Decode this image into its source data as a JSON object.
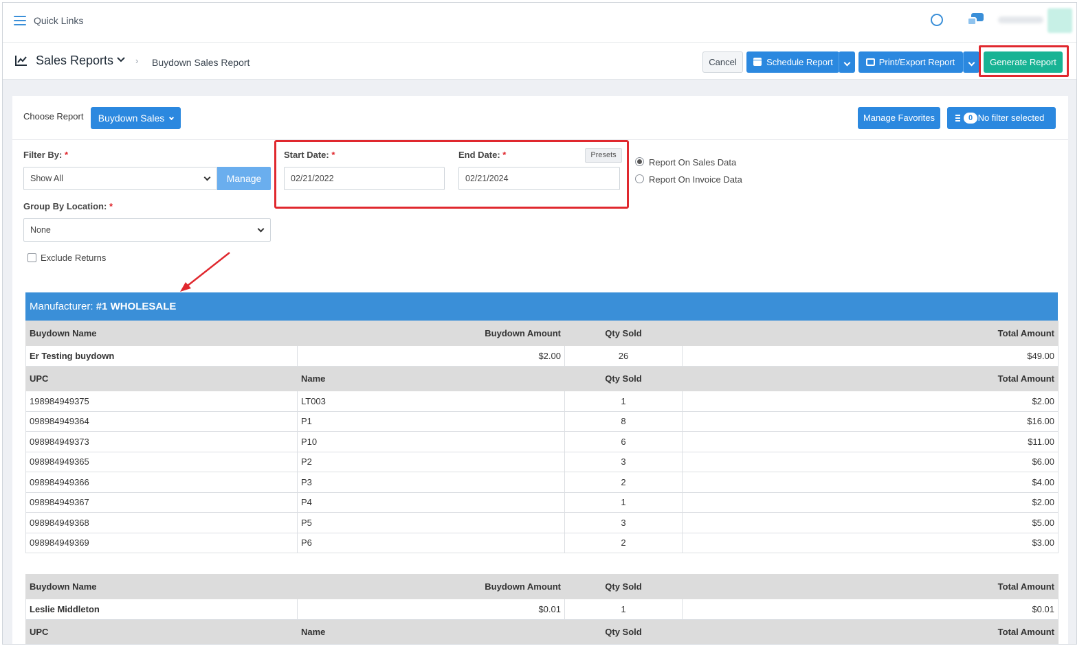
{
  "topbar": {
    "quick_links": "Quick Links"
  },
  "header": {
    "title": "Sales Reports",
    "breadcrumb_current": "Buydown Sales Report",
    "cancel": "Cancel",
    "schedule": "Schedule Report",
    "print_export": "Print/Export Report",
    "generate": "Generate Report"
  },
  "panel": {
    "choose_label": "Choose Report",
    "choose_value": "Buydown Sales",
    "manage_favorites": "Manage Favorites",
    "filter_count": "0",
    "filter_text": "No filter selected"
  },
  "form": {
    "filter_by_label": "Filter By:",
    "filter_by_value": "Show All",
    "manage": "Manage",
    "group_by_label": "Group By Location:",
    "group_by_value": "None",
    "start_label": "Start Date:",
    "start_value": "02/21/2022",
    "end_label": "End Date:",
    "end_value": "02/21/2024",
    "presets": "Presets",
    "radio_sales": "Report On Sales Data",
    "radio_invoice": "Report On Invoice Data",
    "exclude_returns": "Exclude Returns",
    "required": "*"
  },
  "report": {
    "manufacturer_label": "Manufacturer:",
    "manufacturer_name": "#1 WHOLESALE",
    "buydown_headers": {
      "name": "Buydown Name",
      "amount": "Buydown Amount",
      "qty": "Qty Sold",
      "total": "Total Amount"
    },
    "item_headers": {
      "upc": "UPC",
      "name": "Name",
      "qty": "Qty Sold",
      "total": "Total Amount"
    },
    "groups": [
      {
        "name": "Er Testing buydown",
        "amount": "$2.00",
        "qty": "26",
        "total": "$49.00",
        "items": [
          {
            "upc": "198984949375",
            "name": "LT003",
            "qty": "1",
            "total": "$2.00"
          },
          {
            "upc": "098984949364",
            "name": "P1",
            "qty": "8",
            "total": "$16.00"
          },
          {
            "upc": "098984949373",
            "name": "P10",
            "qty": "6",
            "total": "$11.00"
          },
          {
            "upc": "098984949365",
            "name": "P2",
            "qty": "3",
            "total": "$6.00"
          },
          {
            "upc": "098984949366",
            "name": "P3",
            "qty": "2",
            "total": "$4.00"
          },
          {
            "upc": "098984949367",
            "name": "P4",
            "qty": "1",
            "total": "$2.00"
          },
          {
            "upc": "098984949368",
            "name": "P5",
            "qty": "3",
            "total": "$5.00"
          },
          {
            "upc": "098984949369",
            "name": "P6",
            "qty": "2",
            "total": "$3.00"
          }
        ]
      },
      {
        "name": "Leslie Middleton",
        "amount": "$0.01",
        "qty": "1",
        "total": "$0.01",
        "items": []
      }
    ]
  }
}
